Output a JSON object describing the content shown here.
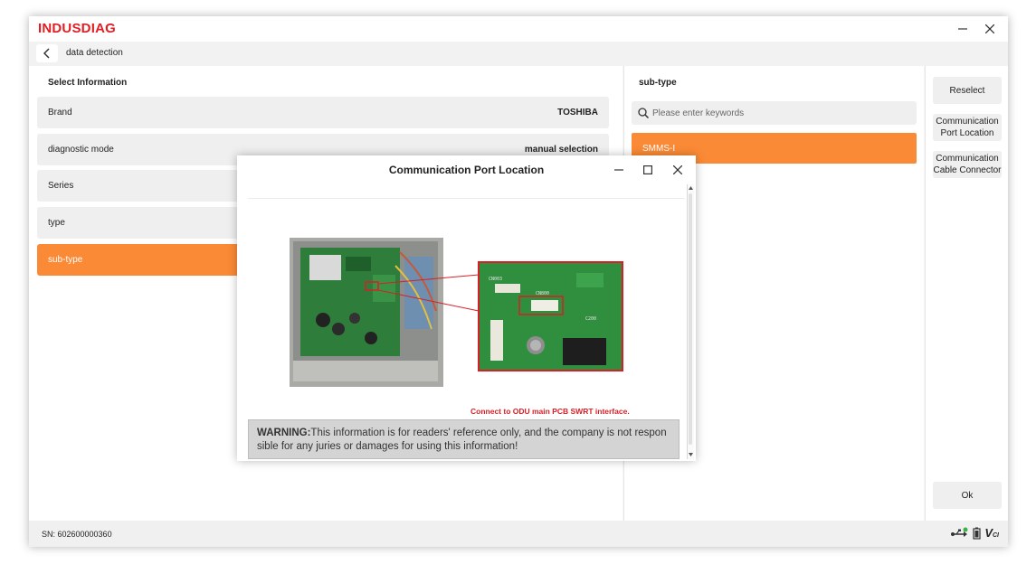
{
  "app": {
    "logo": "INDUSDIAG",
    "nav_title": "data detection"
  },
  "left": {
    "section_title": "Select Information",
    "rows": [
      {
        "label": "Brand",
        "value": "TOSHIBA"
      },
      {
        "label": "diagnostic mode",
        "value": "manual selection"
      },
      {
        "label": "Series",
        "value": ""
      },
      {
        "label": "type",
        "value": ""
      },
      {
        "label": "sub-type",
        "value": ""
      }
    ]
  },
  "middle": {
    "section_title": "sub-type",
    "search_placeholder": "Please enter keywords",
    "options": [
      "SMMS-I"
    ]
  },
  "right": {
    "reselect": "Reselect",
    "comm_port_line1": "Communication",
    "comm_port_line2": "Port Location",
    "comm_cable_line1": "Communication",
    "comm_cable_line2": "Cable Connector",
    "ok": "Ok"
  },
  "status": {
    "sn": "SN: 602600000360",
    "vci": "VCI"
  },
  "dialog": {
    "title": "Communication Port Location",
    "caption": "Connect to ODU main PCB SWRT interface.",
    "warning_label": "WARNING:",
    "warning_text": "This information is for readers' reference only, and the company is not responsible for any juries or damages for using this information!"
  },
  "colors": {
    "brand_red": "#e01e23",
    "accent_orange": "#fb8a36",
    "pcb_green": "#2f8f3e"
  }
}
